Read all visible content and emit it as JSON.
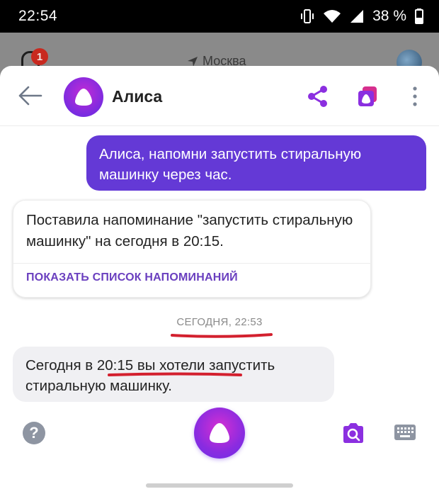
{
  "status_bar": {
    "time": "22:54",
    "battery": "38 %"
  },
  "background_app": {
    "badge_count": "1",
    "city": "Москва"
  },
  "header": {
    "title": "Алиса"
  },
  "messages": {
    "user_1": "Алиса, напомни запустить стиральную машинку через час.",
    "bot_1": "Поставила напоминание \"запустить стиральную машинку\" на сегодня в 20:15.",
    "bot_1_action": "ПОКАЗАТЬ СПИСОК НАПОМИНАНИЙ",
    "timestamp": "СЕГОДНЯ, 22:53",
    "bot_2": "Сегодня в 20:15 вы хотели запустить стиральную машинку."
  },
  "icons": {
    "back": "arrow-left-icon",
    "share": "share-icon",
    "cards": "cards-icon",
    "more": "more-vertical-icon",
    "help": "help-icon",
    "mic": "alice-mic-icon",
    "camera": "camera-search-icon",
    "keyboard": "keyboard-icon"
  },
  "colors": {
    "accent": "#6439d6",
    "action_text": "#6a3fbf",
    "annotation_red": "#d3202e",
    "bot_bubble": "#f0f0f3"
  }
}
